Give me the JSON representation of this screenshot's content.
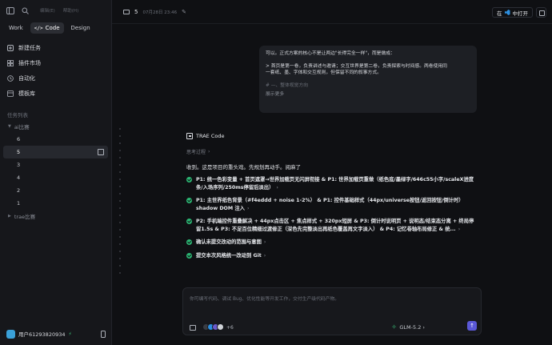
{
  "sidebar": {
    "menu": [
      "编辑(E)",
      "帮助(H)"
    ],
    "modes": [
      {
        "label": "Work",
        "tag": ""
      },
      {
        "label": "Code",
        "tag": "</>"
      },
      {
        "label": "Design",
        "tag": ""
      }
    ],
    "nav": [
      {
        "label": "新建任务"
      },
      {
        "label": "插件市场"
      },
      {
        "label": "自动化"
      },
      {
        "label": "模板库"
      }
    ],
    "tasks_title": "任务列表",
    "group1": "ai比赛",
    "tasks": [
      "6",
      "5",
      "3",
      "4",
      "2",
      "1"
    ],
    "group2": "trae比赛",
    "user": {
      "name": "用户61293820934",
      "badge": "⚡"
    }
  },
  "header": {
    "number": "5",
    "date": "07月28日 23:46",
    "open_label": "中打开",
    "open_prefix": "在"
  },
  "bubble": {
    "line1": "可以。正式方案的核心不是让两边\"长得完全一样\"，而是做成：",
    "line2": "> 首页是第一卷，负责讲述与邀请；交互世界是第二卷，负责探索与时间感。两卷使用同",
    "line3": "一套纸、墨、字体和交互规则，但保留不同的叙事方式。",
    "line4": "# —、整体视觉方向",
    "more": "展示更多"
  },
  "reply": {
    "brand": "TRAE Code",
    "thinking": "思考过程",
    "intro": "收到。这是项目的重头戏。先规划再动手。阅麻了",
    "steps": [
      {
        "text": "P1: 统一色彩变量 + 首页遮罩→世界加载页无闪屏衔接 & P1: 世界加载页重做（纸色底/墨绿字/646c55小字/scaleX进度条/入场序列/250ms停留后淡出）"
      },
      {
        "text": "P1: 主世界纸色背景（#f4eddd + noise 1-2%） & P1: 控件基础样式（44px/universe按钮/返回按钮/倒计时）shadow DOM 注入"
      },
      {
        "text": "P2: 手机端控件重叠解决 + 44px点击区 + 焦点样式 + 320px短屏 & P3: 倒计时说明页 + 说明态/结束态分离 + 终局停留1.5s & P3: 不足百位精细过渡修正（深色先完整淡出再纸色覆盖再文字淡入） & P4: 记忆卷轴布局修正 & 统..."
      },
      {
        "text": "确认未提交改动的范围与意图"
      },
      {
        "text": "提交本次风格统一改动到 Git"
      }
    ]
  },
  "composer": {
    "placeholder": "你可编写代码、调试 Bug、优化性能等开发工作，交付生产级代码产物。",
    "plus_count": "+6",
    "model": "GLM-5.2",
    "send_icon": "↑"
  },
  "colors": {
    "accent": "#5a58d6",
    "success": "#2bb673",
    "vscode": "#2d8fe0"
  }
}
